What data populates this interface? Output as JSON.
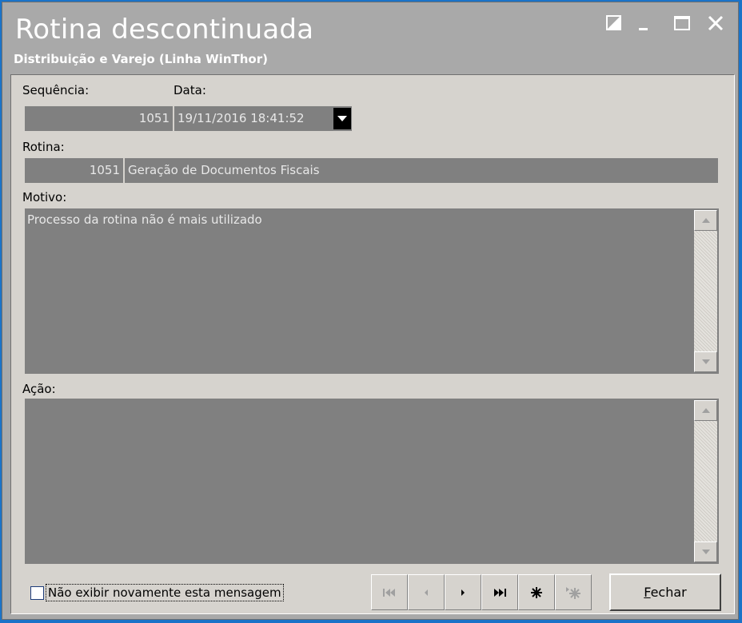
{
  "window": {
    "title": "Rotina descontinuada",
    "subtitle": "Distribuição e Varejo (Linha WinThor)"
  },
  "form": {
    "sequencia_label": "Sequência:",
    "sequencia_value": "1051",
    "data_label": "Data:",
    "data_value": "19/11/2016 18:41:52",
    "rotina_label": "Rotina:",
    "rotina_code": "1051",
    "rotina_name": "Geração de Documentos Fiscais",
    "motivo_label": "Motivo:",
    "motivo_text": "Processo da rotina não é mais utilizado",
    "acao_label": "Ação:",
    "acao_text": ""
  },
  "footer": {
    "checkbox_label": "Não exibir novamente esta mensagem",
    "checkbox_checked": false,
    "close_button_accel": "F",
    "close_button_rest": "echar"
  },
  "navigator": [
    "first-icon",
    "prior-icon",
    "next-icon",
    "last-icon",
    "insert-icon",
    "insert-after-icon"
  ],
  "colors": {
    "titlebar": "#a9a9a9",
    "panel": "#d6d3ce",
    "field": "#808080",
    "desktop": "#1a73c8"
  }
}
